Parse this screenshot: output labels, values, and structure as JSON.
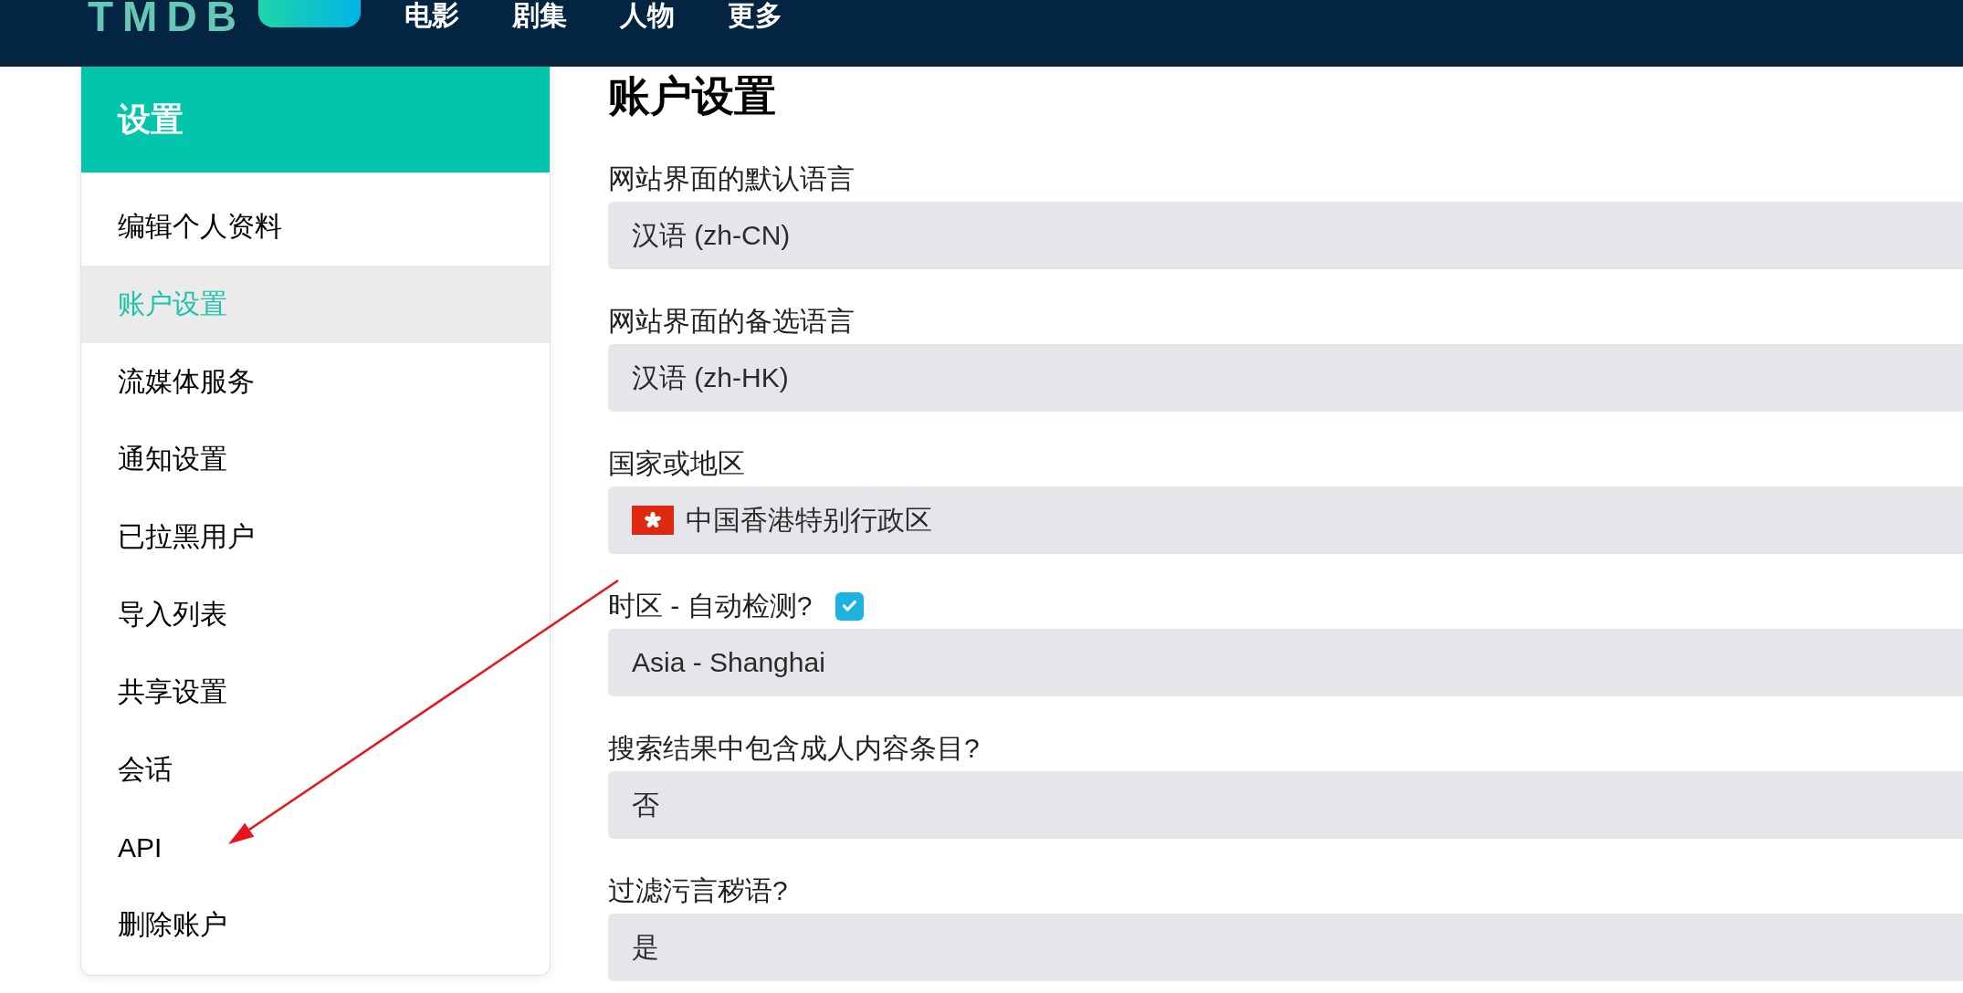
{
  "header": {
    "logo": "TMDB",
    "nav": [
      "电影",
      "剧集",
      "人物",
      "更多"
    ]
  },
  "sidebar": {
    "title": "设置",
    "items": [
      {
        "label": "编辑个人资料",
        "selected": false
      },
      {
        "label": "账户设置",
        "selected": true
      },
      {
        "label": "流媒体服务",
        "selected": false
      },
      {
        "label": "通知设置",
        "selected": false
      },
      {
        "label": "已拉黑用户",
        "selected": false
      },
      {
        "label": "导入列表",
        "selected": false
      },
      {
        "label": "共享设置",
        "selected": false
      },
      {
        "label": "会话",
        "selected": false
      },
      {
        "label": "API",
        "selected": false
      },
      {
        "label": "删除账户",
        "selected": false
      }
    ]
  },
  "page_title": "账户设置",
  "settings": [
    {
      "kind": "select",
      "label": "网站界面的默认语言",
      "value": "汉语 (zh-CN)"
    },
    {
      "kind": "select",
      "label": "网站界面的备选语言",
      "value": "汉语 (zh-HK)"
    },
    {
      "kind": "country",
      "label": "国家或地区",
      "value": "中国香港特别行政区"
    },
    {
      "kind": "select",
      "label": "时区 - 自动检测?",
      "checkbox": {
        "checked": true
      },
      "value": "Asia - Shanghai"
    },
    {
      "kind": "select",
      "label": "搜索结果中包含成人内容条目?",
      "value": "否"
    },
    {
      "kind": "select",
      "label": "过滤污言秽语?",
      "value": "是"
    }
  ]
}
